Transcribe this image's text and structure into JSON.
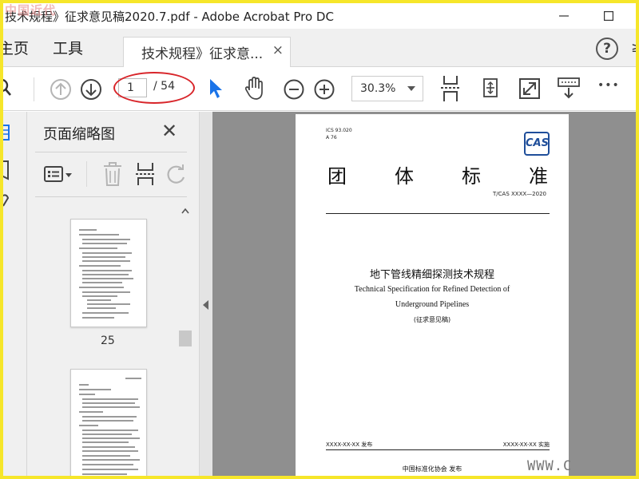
{
  "window": {
    "title": "技术规程》征求意见稿2020.7.pdf - Adobe Acrobat Pro DC",
    "watermark": "中国近代"
  },
  "nav": {
    "home_label": "主页",
    "tools_label": "工具",
    "doc_tab_label": "技术规程》征求意...",
    "doc_tab_close": "×",
    "help_label": "?",
    "right_stub": "≥"
  },
  "toolbar": {
    "page_current": "1",
    "page_total": "/ 54",
    "zoom": "30.3%",
    "more_label": "•••"
  },
  "thumbnail_panel": {
    "title": "页面缩略图",
    "close": "✕",
    "page_label": "25"
  },
  "document": {
    "ics_code": "ICS 93.020\nA 76",
    "logo": "CAS",
    "title_chars": [
      "团",
      "体",
      "标",
      "准"
    ],
    "standard_code": "T/CAS XXXX—2020",
    "zh_title": "地下管线精细探测技术规程",
    "en_title_line1": "Technical Specification for Refined Detection of",
    "en_title_line2": "Underground Pipelines",
    "draft_label": "(征求意见稿)",
    "publish_date": "XXXX-XX-XX 发布",
    "implement_date": "XXXX-XX-XX 实施",
    "publisher": "中国标准化协会 发布"
  },
  "watermark_url": "WWW.C"
}
